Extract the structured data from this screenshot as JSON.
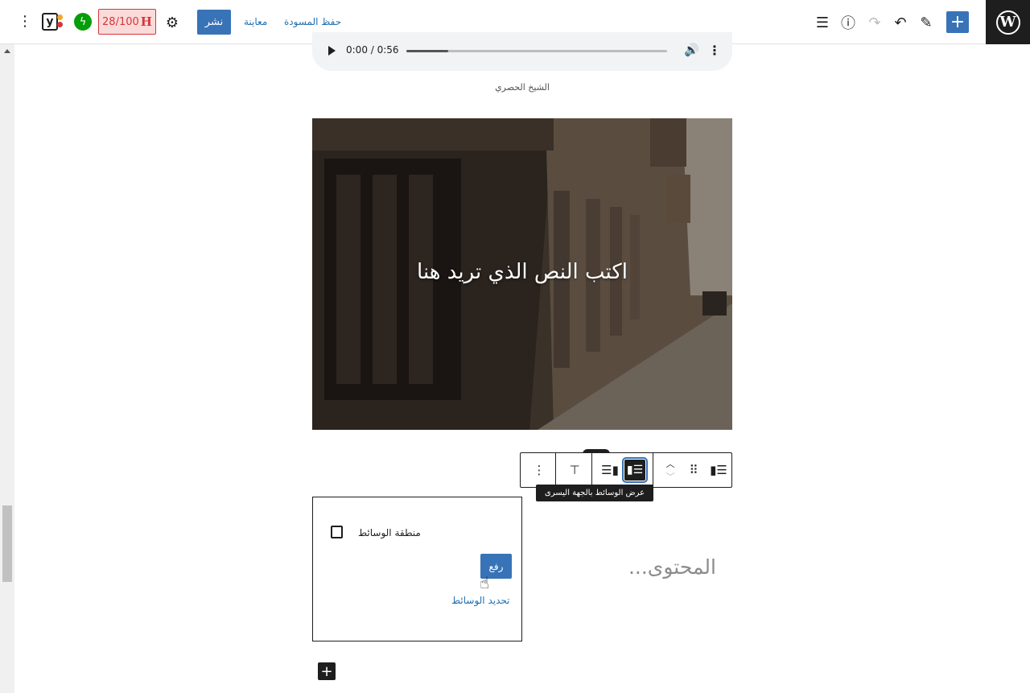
{
  "header": {
    "save_draft": "حفظ المسودة",
    "preview": "معاينة",
    "publish": "نشر",
    "seo_score": "28/100",
    "seo_letter": "H",
    "yoast_letter": "y"
  },
  "audio": {
    "time": "0:00 / 0:56",
    "progress": 0.16,
    "caption": "الشيخ الحصري"
  },
  "cover": {
    "title": "اكتب النص الذي تريد هنا"
  },
  "toolbar": {
    "tooltip": "عرض الوسائط بالجهة اليسرى"
  },
  "media_text": {
    "media_area_label": "منطقة الوسائط",
    "upload": "رفع",
    "select_media": "تحديد الوسائط",
    "content_placeholder": "المحتوى..."
  },
  "colors": {
    "accent": "#3873b7",
    "dark": "#1e1e1e",
    "seo_bad": "#d63638"
  }
}
